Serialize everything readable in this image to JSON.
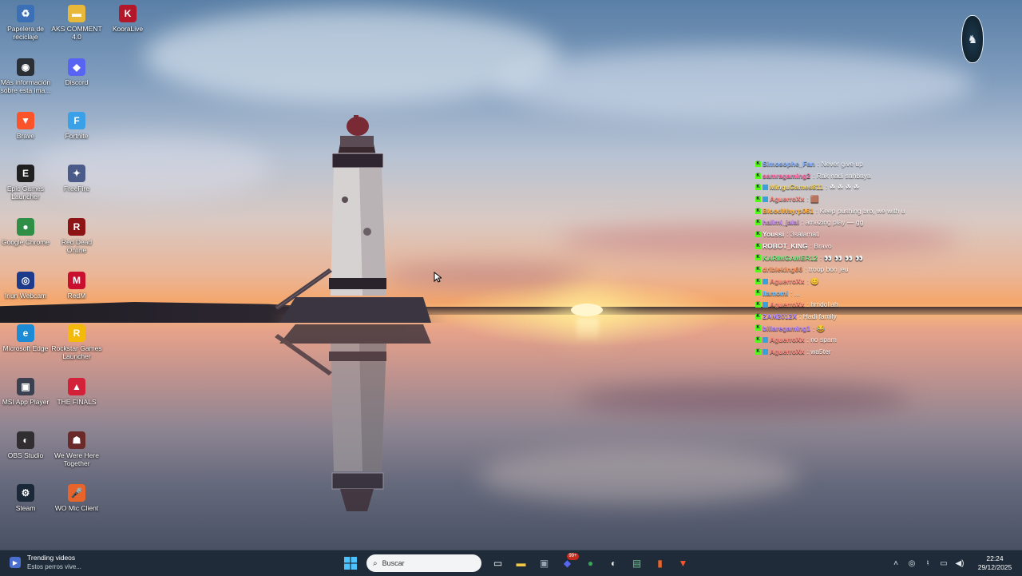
{
  "desktop_icons": [
    {
      "label": "Papelera de reciclaje",
      "icon": "recycle-bin-icon",
      "color": "#3b6fb6",
      "glyph": "♻"
    },
    {
      "label": "AKS COMMENT 4.0",
      "icon": "folder-icon",
      "color": "#e8b83a",
      "glyph": "▬"
    },
    {
      "label": "KooraLive",
      "icon": "kooralive-icon",
      "color": "#b3172a",
      "glyph": "K"
    },
    {
      "label": "Más información sobre esta ima...",
      "icon": "camera-icon",
      "color": "#2b2f36",
      "glyph": "◉"
    },
    {
      "label": "Discord",
      "icon": "discord-icon",
      "color": "#5865f2",
      "glyph": "◆"
    },
    {
      "label": "Brave",
      "icon": "brave-icon",
      "color": "#fb542b",
      "glyph": "▼"
    },
    {
      "label": "Fortnite",
      "icon": "fortnite-icon",
      "color": "#3aa0e8",
      "glyph": "F"
    },
    {
      "label": "Epic Games Launcher",
      "icon": "epic-games-icon",
      "color": "#202020",
      "glyph": "E"
    },
    {
      "label": "FreeFire",
      "icon": "freefire-icon",
      "color": "#4a5b8a",
      "glyph": "✦"
    },
    {
      "label": "Google Chrome",
      "icon": "chrome-icon",
      "color": "#2f8f46",
      "glyph": "●"
    },
    {
      "label": "Red Dead Online",
      "icon": "red-dead-icon",
      "color": "#8c1414",
      "glyph": "R"
    },
    {
      "label": "Iriun Webcam",
      "icon": "webcam-icon",
      "color": "#1e3a8a",
      "glyph": "◎"
    },
    {
      "label": "RedM",
      "icon": "redm-icon",
      "color": "#c8102e",
      "glyph": "M"
    },
    {
      "label": "Microsoft Edge",
      "icon": "edge-icon",
      "color": "#1b8bd6",
      "glyph": "e"
    },
    {
      "label": "Rockstar Games Launcher",
      "icon": "rockstar-icon",
      "color": "#f5b90a",
      "glyph": "R"
    },
    {
      "label": "MSI App Player",
      "icon": "msi-player-icon",
      "color": "#3b4150",
      "glyph": "▣"
    },
    {
      "label": "THE FINALS",
      "icon": "the-finals-icon",
      "color": "#d4213a",
      "glyph": "▲"
    },
    {
      "label": "OBS Studio",
      "icon": "obs-icon",
      "color": "#302e31",
      "glyph": "◐"
    },
    {
      "label": "We Were Here Together",
      "icon": "we-were-here-icon",
      "color": "#6b2a2a",
      "glyph": "☗"
    },
    {
      "label": "Steam",
      "icon": "steam-icon",
      "color": "#1b2838",
      "glyph": "⚙"
    },
    {
      "label": "WO Mic Client",
      "icon": "microphone-icon",
      "color": "#e8642a",
      "glyph": "🎤"
    }
  ],
  "chat": {
    "messages": [
      {
        "user": "Simosophe_Fan",
        "user_color": "#8ab4ff",
        "text": ": Never give up"
      },
      {
        "user": "samragaming2",
        "user_color": "#ff6fa8",
        "text": ": Rak nadi sahbaya"
      },
      {
        "user": "MinguGames811",
        "user_color": "#f5d76e",
        "text": ": ☘ ☘ ☘ ☘"
      },
      {
        "user": "AguerroXx",
        "user_color": "#ff8a80",
        "text": ": 🟫"
      },
      {
        "user": "BloodWayrp061",
        "user_color": "#ffb347",
        "text": ": Keep pushing bro, we with u"
      },
      {
        "user": "halimi_jalal",
        "user_color": "#c792ea",
        "text": ": amazing play — gg"
      },
      {
        "user": "Youssi",
        "user_color": "#ffffff",
        "text": ": 3salamati"
      },
      {
        "user": "ROBOT_KING",
        "user_color": "#ffffff",
        "text": ": Bravo"
      },
      {
        "user": "KARIMGAMER12",
        "user_color": "#7ee787",
        "text": ": 👀 👀 👀 👀"
      },
      {
        "user": "dribleking66",
        "user_color": "#ff9966",
        "text": ": troop bon jeu"
      },
      {
        "user": "AguerroXx",
        "user_color": "#ff8a80",
        "text": ": 😊"
      },
      {
        "user": "Ilamomi",
        "user_color": "#6ec1ff",
        "text": ": ..."
      },
      {
        "user": "AguerroXx",
        "user_color": "#ff8a80",
        "text": ": hmdollah"
      },
      {
        "user": "ZAM2012X",
        "user_color": "#b18cff",
        "text": ": Hadi family"
      },
      {
        "user": "billaregaming1",
        "user_color": "#b18cff",
        "text": ": 😂"
      },
      {
        "user": "AguerroXx",
        "user_color": "#ff8a80",
        "text": ": no spam"
      },
      {
        "user": "AguerroXx",
        "user_color": "#ff8a80",
        "text": ": wa5ter"
      }
    ]
  },
  "taskbar": {
    "widget_title": "Trending videos",
    "widget_subtitle": "Estos perros vive...",
    "search_placeholder": "Buscar",
    "discord_badge": "99+",
    "pinned": [
      {
        "name": "task-view-icon",
        "glyph": "▭",
        "color": "#ffffff"
      },
      {
        "name": "file-explorer-icon",
        "glyph": "▬",
        "color": "#f2c744"
      },
      {
        "name": "terminal-icon",
        "glyph": "▣",
        "color": "#9aa4b2"
      },
      {
        "name": "discord-icon",
        "glyph": "◆",
        "color": "#5865f2"
      },
      {
        "name": "chrome-icon",
        "glyph": "●",
        "color": "#34a853"
      },
      {
        "name": "obs-icon",
        "glyph": "◐",
        "color": "#e6e6e6"
      },
      {
        "name": "notepad-icon",
        "glyph": "▤",
        "color": "#6cc08b"
      },
      {
        "name": "microphone-icon",
        "glyph": "▮",
        "color": "#e8642a"
      },
      {
        "name": "brave-icon",
        "glyph": "▼",
        "color": "#fb542b"
      }
    ],
    "tray": {
      "time": "22:24",
      "date": "29/12/2025"
    }
  },
  "colors": {
    "taskbar_bg": "#1f2b38",
    "accent": "#0078d4",
    "chat_badge": "#53fc18"
  }
}
